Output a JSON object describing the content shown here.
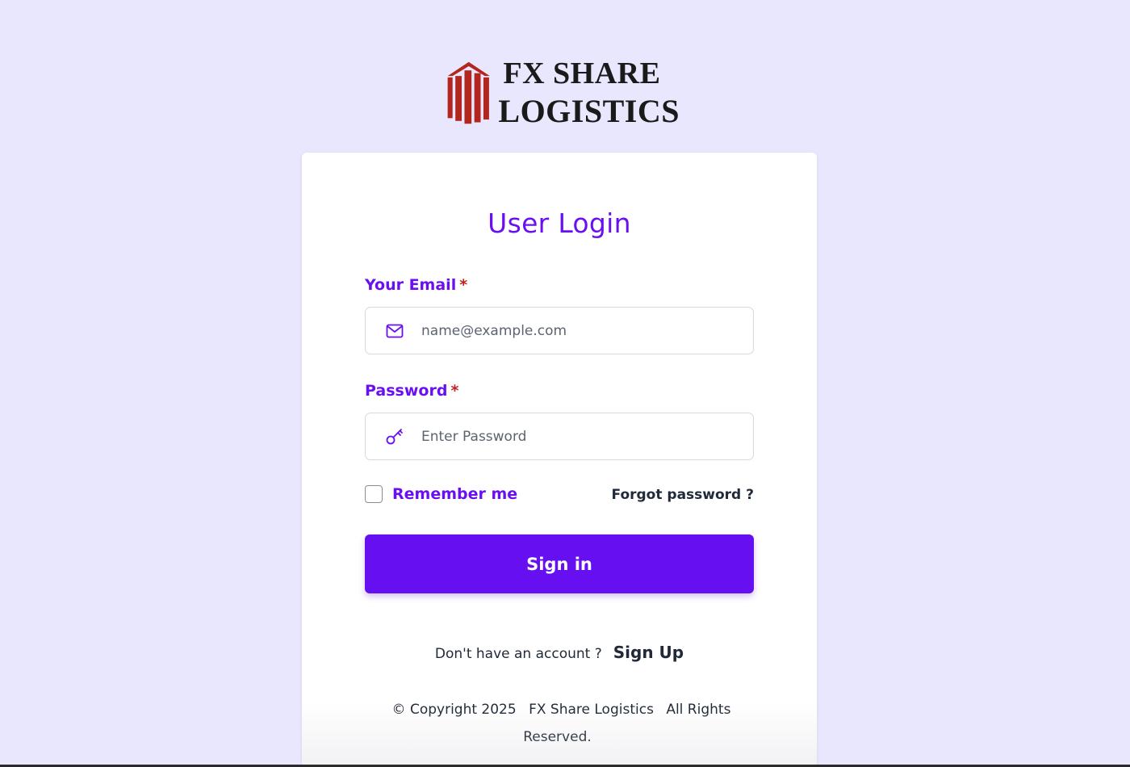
{
  "brand": {
    "line1": "FX SHARE",
    "line2": "LOGISTICS",
    "mark_color": "#b3261e"
  },
  "login": {
    "title": "User Login",
    "email_label": "Your Email",
    "email_required": "*",
    "email_placeholder": "name@example.com",
    "email_value": "",
    "email_icon": "mail-icon",
    "password_label": "Password",
    "password_required": "*",
    "password_placeholder": "Enter Password",
    "password_value": "",
    "password_icon": "key-icon",
    "remember_label": "Remember me",
    "remember_checked": false,
    "forgot_label": "Forgot password ?",
    "signin_label": "Sign in",
    "no_account_text": "Don't have an account ?",
    "signup_label": "Sign Up"
  },
  "footer": {
    "copyright": "© Copyright 2025",
    "company": "FX Share Logistics",
    "rights": "All Rights Reserved."
  },
  "colors": {
    "accent": "#6610f2",
    "label": "#6a10f0",
    "required": "#c81e1e",
    "background": "#e9e7fd"
  }
}
